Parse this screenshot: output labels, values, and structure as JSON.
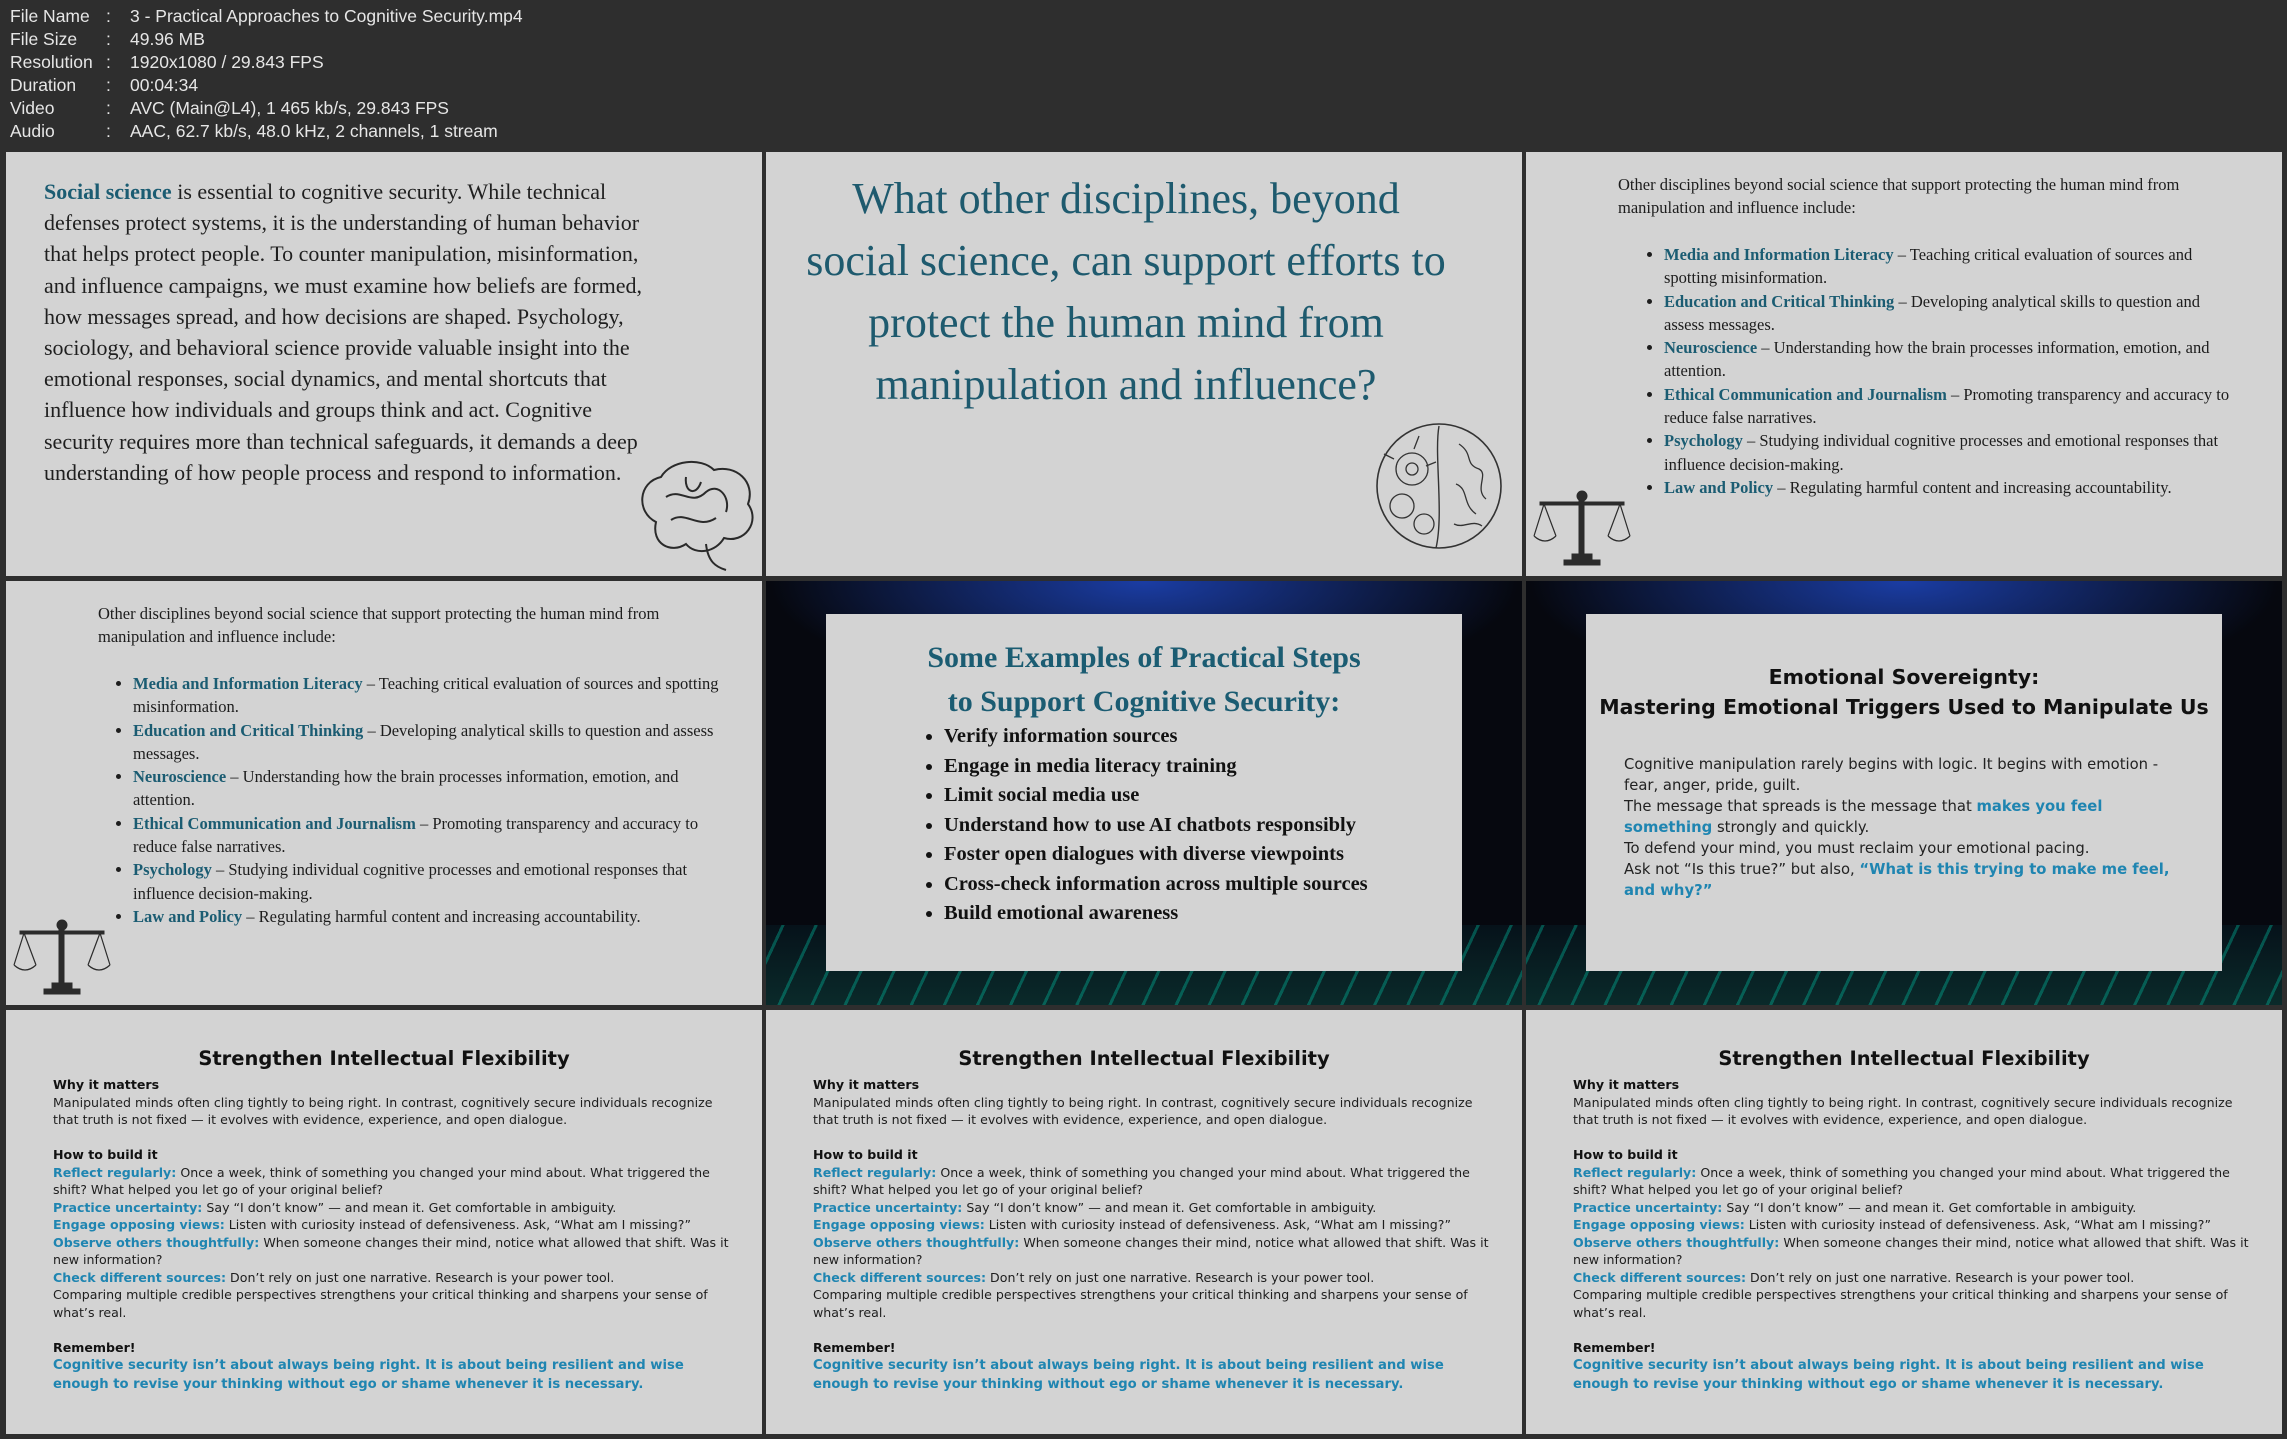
{
  "media_info": [
    {
      "key": "File Name",
      "value": "3 - Practical Approaches to Cognitive Security.mp4"
    },
    {
      "key": "File Size",
      "value": "49.96 MB"
    },
    {
      "key": "Resolution",
      "value": "1920x1080 / 29.843 FPS"
    },
    {
      "key": "Duration",
      "value": "00:04:34"
    },
    {
      "key": "Video",
      "value": "AVC (Main@L4), 1 465 kb/s, 29.843 FPS"
    },
    {
      "key": "Audio",
      "value": "AAC, 62.7 kb/s, 48.0 kHz, 2 channels, 1 stream"
    }
  ],
  "separator": ":",
  "slide1": {
    "highlight": "Social science",
    "text": " is essential to cognitive security. While technical defenses protect systems, it is the understanding of human behavior that helps protect people. To counter manipulation, misinformation, and influence campaigns, we must examine how beliefs are formed, how messages spread, and how decisions are shaped. Psychology, sociology, and behavioral science provide valuable insight into the emotional responses, social dynamics, and mental shortcuts that influence how individuals and groups think and act. Cognitive security requires more than technical safeguards, it demands a deep understanding of how people process and respond to information.",
    "icon": "brain-line-icon"
  },
  "slide2": {
    "question": "What other disciplines, beyond social science, can support efforts to protect the human mind from manipulation and influence?",
    "icon": "floral-brain-icon"
  },
  "disciplines": {
    "intro": "Other disciplines beyond social science that support protecting the human mind from manipulation and influence include:",
    "items": [
      {
        "term": "Media and Information Literacy",
        "desc": " – Teaching critical evaluation of sources and spotting misinformation."
      },
      {
        "term": "Education and Critical Thinking",
        "desc": " – Developing analytical skills to question and assess messages."
      },
      {
        "term": "Neuroscience",
        "desc": " – Understanding how the brain processes information, emotion, and attention."
      },
      {
        "term": "Ethical Communication and Journalism",
        "desc": " – Promoting transparency and accuracy to reduce false narratives."
      },
      {
        "term": "Psychology",
        "desc": " – Studying individual cognitive processes and emotional responses that influence decision-making."
      },
      {
        "term": "Law and Policy",
        "desc": " – Regulating harmful content and increasing accountability."
      }
    ],
    "icon": "justice-scale-icon"
  },
  "slide5": {
    "title_line1": "Some Examples of Practical Steps",
    "title_line2": "to Support Cognitive Security:",
    "steps": [
      "Verify information sources",
      "Engage in media literacy training",
      "Limit social media use",
      "Understand how to use AI chatbots responsibly",
      "Foster open dialogues with diverse viewpoints",
      "Cross-check information across multiple sources",
      "Build emotional awareness"
    ]
  },
  "slide6": {
    "title_line1": "Emotional Sovereignty:",
    "title_line2": "Mastering Emotional Triggers Used to Manipulate Us",
    "p1": "Cognitive manipulation rarely begins with logic. It begins with emotion - fear, anger, pride, guilt.",
    "p2_pre": "The message that spreads is the message that ",
    "p2_em": "makes you feel something",
    "p2_post": " strongly and quickly.",
    "p3": "To defend your mind, you must reclaim your emotional pacing.",
    "p4_pre": "Ask not “Is this true?” but also, ",
    "p4_em": "“What is this trying to make me feel, and why?”"
  },
  "flex": {
    "title": "Strengthen Intellectual Flexibility",
    "why_heading": "Why it matters",
    "why_text": "Manipulated minds often cling tightly to being right. In contrast, cognitively secure individuals recognize that truth is not fixed — it evolves with evidence, experience, and open dialogue.",
    "how_heading": "How to build it",
    "r1_label": "Reflect regularly:",
    "r1_text": " Once a week, think of something you changed your mind about. What triggered the shift? What helped you let go of your original belief?",
    "r2_label": "Practice uncertainty:",
    "r2_text": " Say “I don’t know” — and mean it. Get comfortable in ambiguity.",
    "r3_label": "Engage opposing views:",
    "r3_text": " Listen with curiosity instead of defensiveness. Ask, “What am I missing?”",
    "r4_label": "Observe others thoughtfully:",
    "r4_text": " When someone changes their mind, notice what allowed that shift. Was it new information?",
    "r5_label": "Check different sources:",
    "r5_text": " Don’t rely on just one narrative. Research is your power tool.",
    "r6_text": "Comparing multiple credible perspectives strengthens your critical thinking and sharpens your sense of what’s real.",
    "remember_heading": "Remember!",
    "remember_text": "Cognitive security isn’t about always being right. It is about being resilient and wise enough to revise your thinking without ego or shame whenever it is necessary."
  }
}
